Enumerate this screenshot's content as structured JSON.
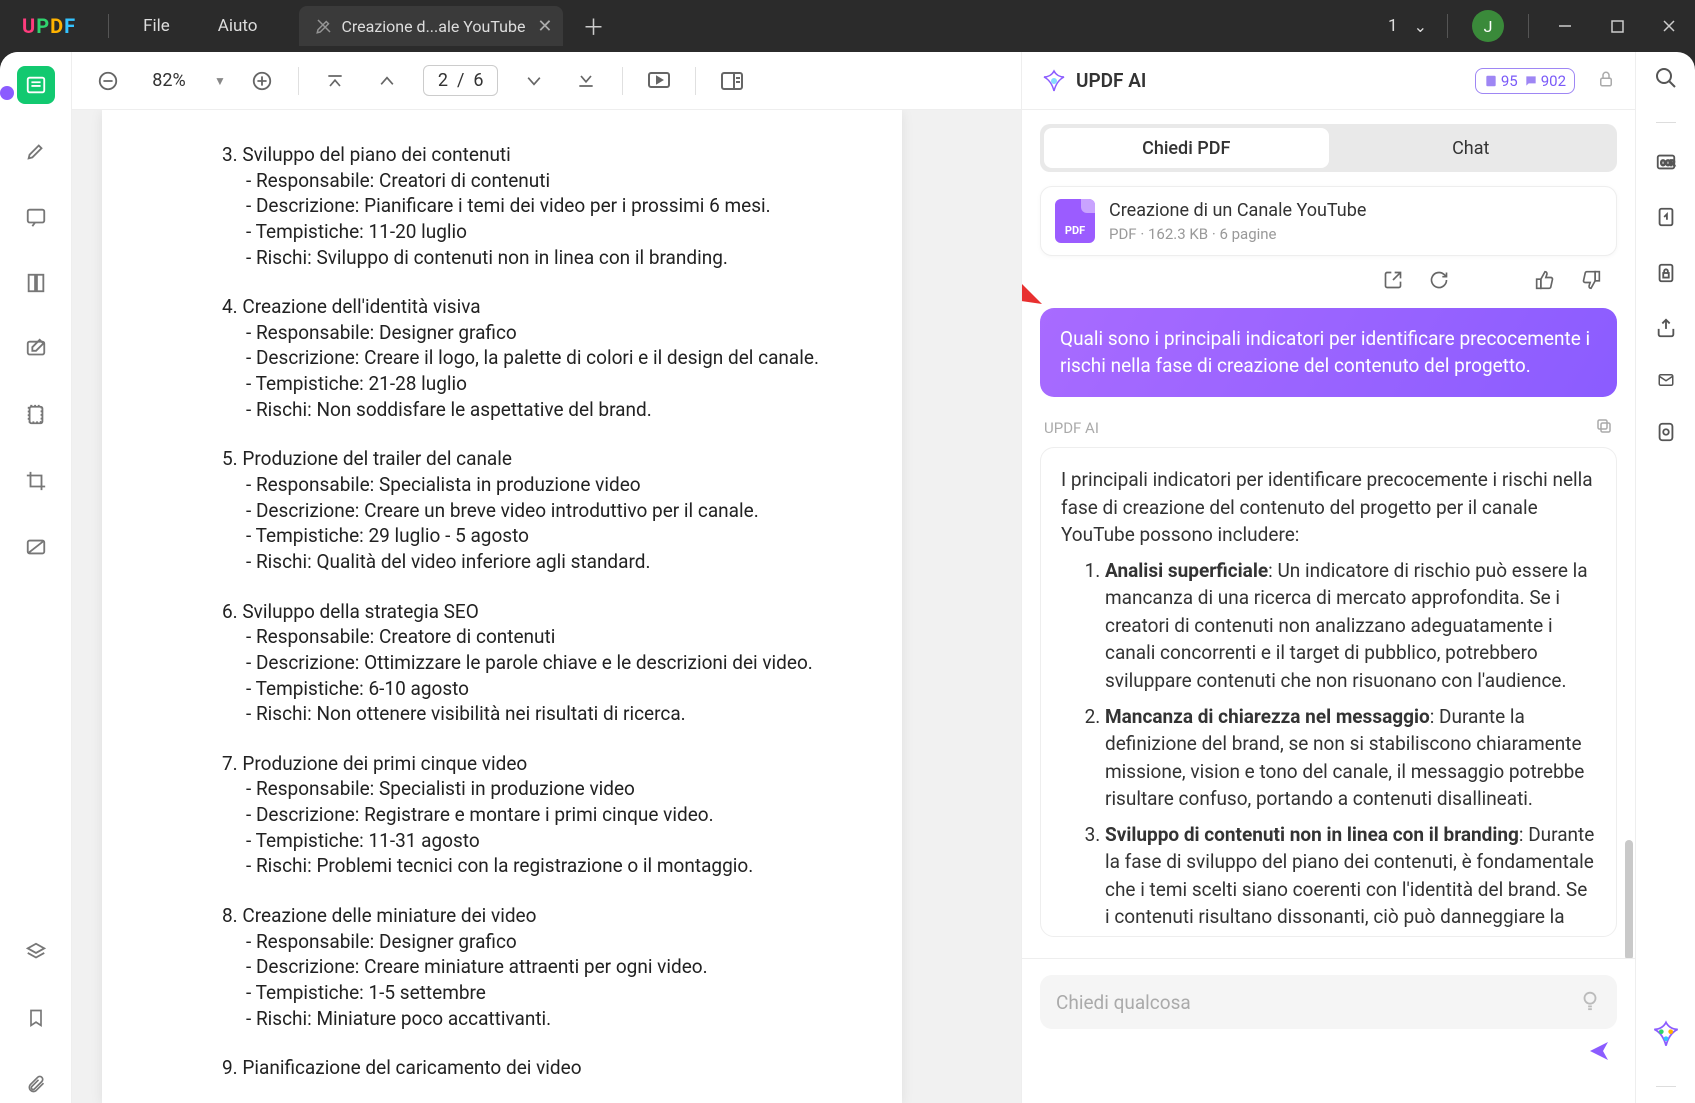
{
  "titlebar": {
    "menus": {
      "file": "File",
      "help": "Aiuto"
    },
    "tab": {
      "label": "Creazione d...ale YouTube"
    },
    "window_count": "1",
    "avatar_initial": "J"
  },
  "toolbar": {
    "zoom": "82%",
    "page_current": "2",
    "page_sep": "/",
    "page_total": "6"
  },
  "document": {
    "sections": [
      {
        "num": "3.",
        "title": "Sviluppo del piano dei contenuti",
        "lines": [
          "- Responsabile: Creatori di contenuti",
          "- Descrizione: Pianificare i temi dei video per i prossimi 6 mesi.",
          "- Tempistiche: 11-20 luglio",
          "- Rischi: Sviluppo di contenuti non in linea con il branding."
        ]
      },
      {
        "num": "4.",
        "title": "Creazione dell'identità visiva",
        "lines": [
          "- Responsabile: Designer grafico",
          "- Descrizione: Creare il logo, la palette di colori e il design del canale.",
          "- Tempistiche: 21-28 luglio",
          "- Rischi: Non soddisfare le aspettative del brand."
        ]
      },
      {
        "num": "5.",
        "title": "Produzione del trailer del canale",
        "lines": [
          "- Responsabile: Specialista in produzione video",
          "- Descrizione: Creare un breve video introduttivo per il canale.",
          "- Tempistiche: 29 luglio - 5 agosto",
          "- Rischi: Qualità del video inferiore agli standard."
        ]
      },
      {
        "num": "6.",
        "title": "Sviluppo della strategia SEO",
        "lines": [
          "- Responsabile: Creatore di contenuti",
          "- Descrizione: Ottimizzare le parole chiave e le descrizioni dei video.",
          "- Tempistiche: 6-10 agosto",
          "- Rischi: Non ottenere visibilità nei risultati di ricerca."
        ]
      },
      {
        "num": "7.",
        "title": "Produzione dei primi cinque video",
        "lines": [
          "- Responsabile: Specialisti in produzione video",
          "- Descrizione: Registrare e montare i primi cinque video.",
          "- Tempistiche: 11-31 agosto",
          "- Rischi: Problemi tecnici con la registrazione o il montaggio."
        ]
      },
      {
        "num": "8.",
        "title": "Creazione delle miniature dei video",
        "lines": [
          "- Responsabile: Designer grafico",
          "- Descrizione: Creare miniature attraenti per ogni video.",
          "- Tempistiche: 1-5 settembre",
          "- Rischi: Miniature poco accattivanti."
        ]
      },
      {
        "num": "9.",
        "title": "Pianificazione del caricamento dei video",
        "lines": []
      }
    ]
  },
  "ai": {
    "title": "UPDF AI",
    "credits": {
      "a": "95",
      "b": "902"
    },
    "modes": {
      "askpdf": "Chiedi PDF",
      "chat": "Chat"
    },
    "file": {
      "name": "Creazione di un Canale YouTube",
      "meta": "PDF · 162.3 KB · 6 pagine"
    },
    "user_question": "Quali sono i principali indicatori per identificare precocemente i rischi nella fase di creazione del contenuto del progetto.",
    "label": "UPDF AI",
    "answer_intro": "I principali indicatori per identificare precocemente i rischi nella fase di creazione del contenuto del progetto per il canale YouTube possono includere:",
    "answer_items": [
      {
        "b": "Analisi superficiale",
        "t": ": Un indicatore di rischio può essere la mancanza di una ricerca di mercato approfondita. Se i creatori di contenuti non analizzano adeguatamente i canali concorrenti e il target di pubblico, potrebbero sviluppare contenuti che non risuonano con l'audience."
      },
      {
        "b": "Mancanza di chiarezza nel messaggio",
        "t": ": Durante la definizione del brand, se non si stabiliscono chiaramente missione, vision e tono del canale, il messaggio potrebbe risultare confuso, portando a contenuti disallineati."
      },
      {
        "b": "Sviluppo di contenuti non in linea con il branding",
        "t": ": Durante la fase di sviluppo del piano dei contenuti, è fondamentale che i temi scelti siano coerenti con l'identità del brand. Se i contenuti risultano dissonanti, ciò può danneggiare la reputazione del canale."
      }
    ],
    "input_placeholder": "Chiedi qualcosa"
  }
}
